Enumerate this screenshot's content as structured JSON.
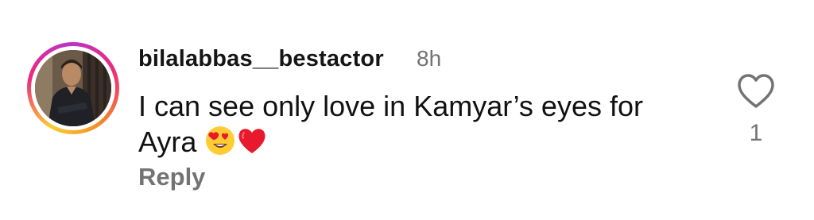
{
  "comment": {
    "username": "bilalabbas__bestactor",
    "time_ago": "8h",
    "text_line1": "I can see only love in Kamyar’s eyes for",
    "text_line2": "Ayra",
    "emojis": [
      "heart-eyes-emoji",
      "red-heart-emoji"
    ],
    "reply_label": "Reply",
    "like_count": "1"
  },
  "colors": {
    "story_ring": [
      "#f9ce34",
      "#ee2a7b",
      "#b934c9",
      "#f58529"
    ],
    "secondary_text": "#737373",
    "primary_text": "#111111"
  },
  "icons": {
    "like": "heart-outline-icon"
  }
}
